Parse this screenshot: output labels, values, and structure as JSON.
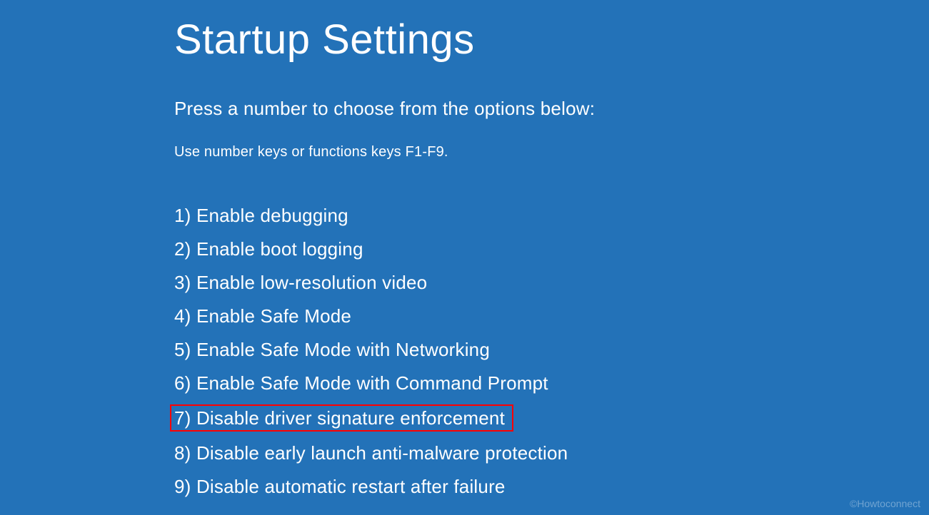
{
  "title": "Startup Settings",
  "subtitle": "Press a number to choose from the options below:",
  "hint": "Use number keys or functions keys F1-F9.",
  "options": [
    {
      "num": "1",
      "label": "Enable debugging",
      "highlighted": false
    },
    {
      "num": "2",
      "label": "Enable boot logging",
      "highlighted": false
    },
    {
      "num": "3",
      "label": "Enable low-resolution video",
      "highlighted": false
    },
    {
      "num": "4",
      "label": "Enable Safe Mode",
      "highlighted": false
    },
    {
      "num": "5",
      "label": "Enable Safe Mode with Networking",
      "highlighted": false
    },
    {
      "num": "6",
      "label": "Enable Safe Mode with Command Prompt",
      "highlighted": false
    },
    {
      "num": "7",
      "label": "Disable driver signature enforcement",
      "highlighted": true
    },
    {
      "num": "8",
      "label": "Disable early launch anti-malware protection",
      "highlighted": false
    },
    {
      "num": "9",
      "label": "Disable automatic restart after failure",
      "highlighted": false
    }
  ],
  "watermark": "©Howtoconnect"
}
